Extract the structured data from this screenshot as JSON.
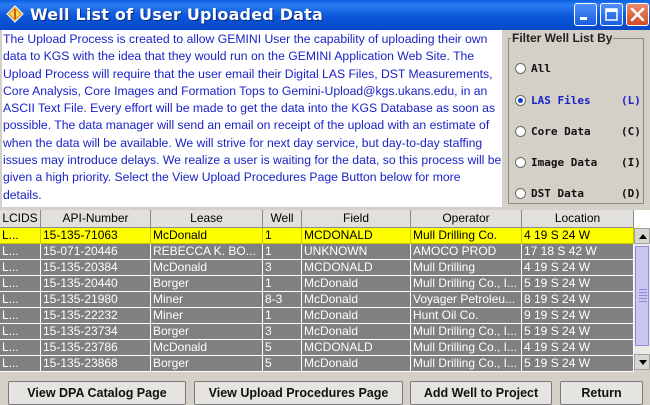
{
  "window": {
    "title": "Well List of User Uploaded Data",
    "icons": {
      "app": "kgs-logo-icon",
      "minimize": "minimize-icon",
      "maximize": "maximize-icon",
      "close": "close-icon"
    }
  },
  "description": {
    "text": "The Upload Process is created to allow GEMINI User the capability of uploading their own data to KGS with the idea that they would run on the GEMINI Application Web Site.  The Upload Process will require that the user email their Digital LAS Files, DST Measurements, Core Analysis, Core Images and Formation Tops to Gemini-Upload@kgs.ukans.edu, in an ASCII Text File.  Every effort will be made to get the data into the KGS Database as soon as possible.  The data manager will send an email on receipt of the upload with an estimate of when the data will be available.  We will strive for next day service, but day-to-day staffing issues may introduce delays.  We realize a user is waiting for the data, so this process will be given a high priority. Select the View Upload Procedures Page Button below for more details."
  },
  "filter": {
    "legend": "Filter Well List By",
    "options": [
      {
        "label": "All",
        "shortcut": "",
        "selected": false
      },
      {
        "label": "LAS Files",
        "shortcut": "(L)",
        "selected": true
      },
      {
        "label": "Core Data",
        "shortcut": "(C)",
        "selected": false
      },
      {
        "label": "Image Data",
        "shortcut": "(I)",
        "selected": false
      },
      {
        "label": "DST Data",
        "shortcut": "(D)",
        "selected": false
      }
    ]
  },
  "table": {
    "columns": [
      "LCIDS",
      "API-Number",
      "Lease",
      "Well",
      "Field",
      "Operator",
      "Location"
    ],
    "rows": [
      [
        "L...",
        "15-135-71063",
        "McDonald",
        "1",
        "MCDONALD",
        "Mull Drilling Co.",
        "4 19 S 24 W"
      ],
      [
        "L...",
        "15-071-20446",
        "REBECCA K. BO...",
        "1",
        "UNKNOWN",
        "AMOCO PROD",
        "17 18 S 42 W"
      ],
      [
        "L...",
        "15-135-20384",
        "McDonald",
        "3",
        "MCDONALD",
        "Mull Drilling",
        "4 19 S 24 W"
      ],
      [
        "L...",
        "15-135-20440",
        "Borger",
        "1",
        "McDonald",
        "Mull Drilling Co., I...",
        "5 19 S 24 W"
      ],
      [
        "L...",
        "15-135-21980",
        "Miner",
        "8-3",
        "McDonald",
        "Voyager Petroleu...",
        "8 19 S 24 W"
      ],
      [
        "L...",
        "15-135-22232",
        "Miner",
        "1",
        "McDonald",
        "Hunt Oil Co.",
        "9 19 S 24 W"
      ],
      [
        "L...",
        "15-135-23734",
        "Borger",
        "3",
        "McDonald",
        "Mull Drilling Co., I...",
        "5 19 S 24 W"
      ],
      [
        "L...",
        "15-135-23786",
        "McDonald",
        "5",
        "MCDONALD",
        "Mull Drilling Co., I...",
        "4 19 S 24 W"
      ],
      [
        "L...",
        "15-135-23868",
        "Borger",
        "5",
        "McDonald",
        "Mull Drilling Co., I...",
        "5 19 S 24 W"
      ]
    ],
    "selected_row": 0,
    "colors": {
      "selected_bg": "#ffff00",
      "row_bg": "#808080",
      "header_bg": "#e2e0dc"
    }
  },
  "buttons": {
    "dpa_catalog": "View DPA Catalog Page",
    "upload_procedures": "View Upload Procedures Page",
    "add_well": "Add Well to Project",
    "return": "Return"
  },
  "colors": {
    "title_bar": "#0a56d8",
    "description_text": "#1a22c8",
    "window_bg": "#d4d0c8"
  }
}
